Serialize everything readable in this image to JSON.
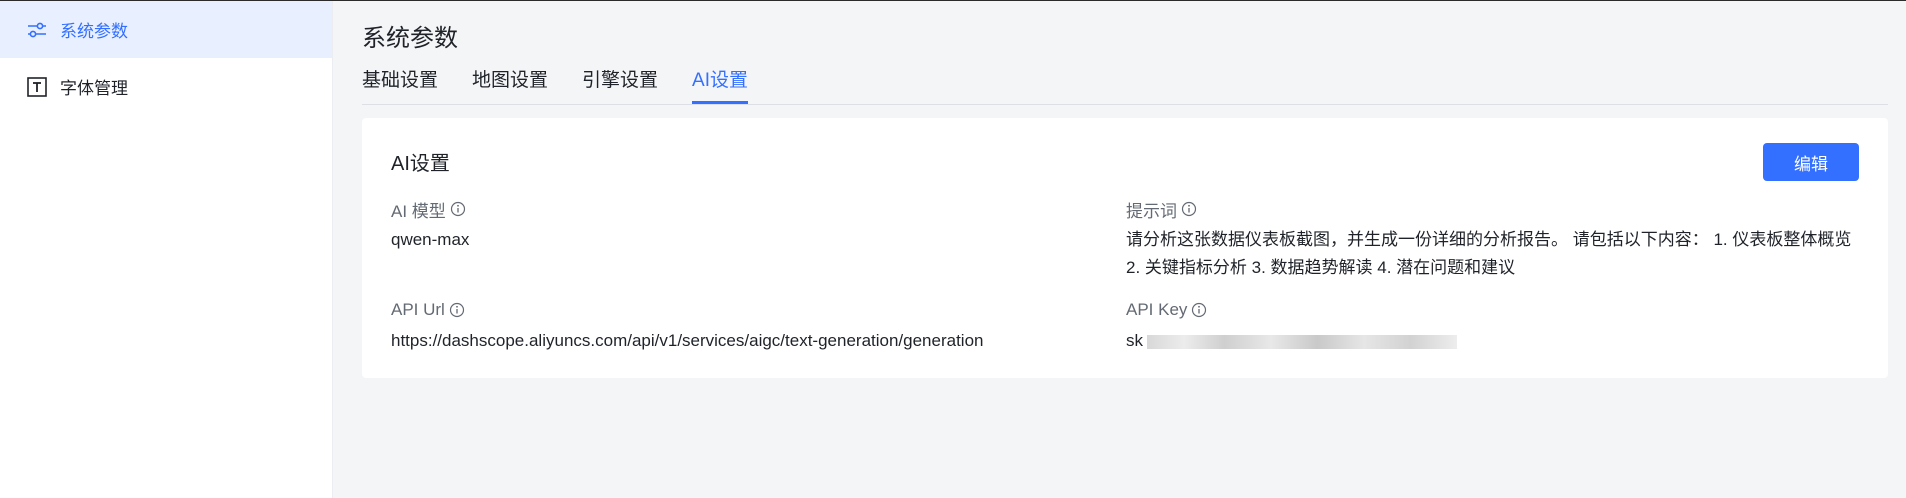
{
  "sidebar": {
    "items": [
      {
        "label": "系统参数",
        "icon": "sliders-icon",
        "active": true
      },
      {
        "label": "字体管理",
        "icon": "font-icon",
        "active": false
      }
    ]
  },
  "main": {
    "title": "系统参数",
    "tabs": [
      {
        "label": "基础设置",
        "active": false
      },
      {
        "label": "地图设置",
        "active": false
      },
      {
        "label": "引擎设置",
        "active": false
      },
      {
        "label": "AI设置",
        "active": true
      }
    ],
    "card": {
      "title": "AI设置",
      "edit_label": "编辑",
      "fields": {
        "model": {
          "label": "AI 模型",
          "value": "qwen-max"
        },
        "prompt": {
          "label": "提示词",
          "value": "请分析这张数据仪表板截图，并生成一份详细的分析报告。 请包括以下内容： 1. 仪表板整体概览 2. 关键指标分析 3. 数据趋势解读 4. 潜在问题和建议"
        },
        "api_url": {
          "label": "API Url",
          "value": "https://dashscope.aliyuncs.com/api/v1/services/aigc/text-generation/generation"
        },
        "api_key": {
          "label": "API Key",
          "value_visible": "sk"
        }
      }
    }
  },
  "colors": {
    "accent": "#3370ff",
    "active_bg": "#e8efff",
    "page_bg": "#f4f5f7"
  }
}
